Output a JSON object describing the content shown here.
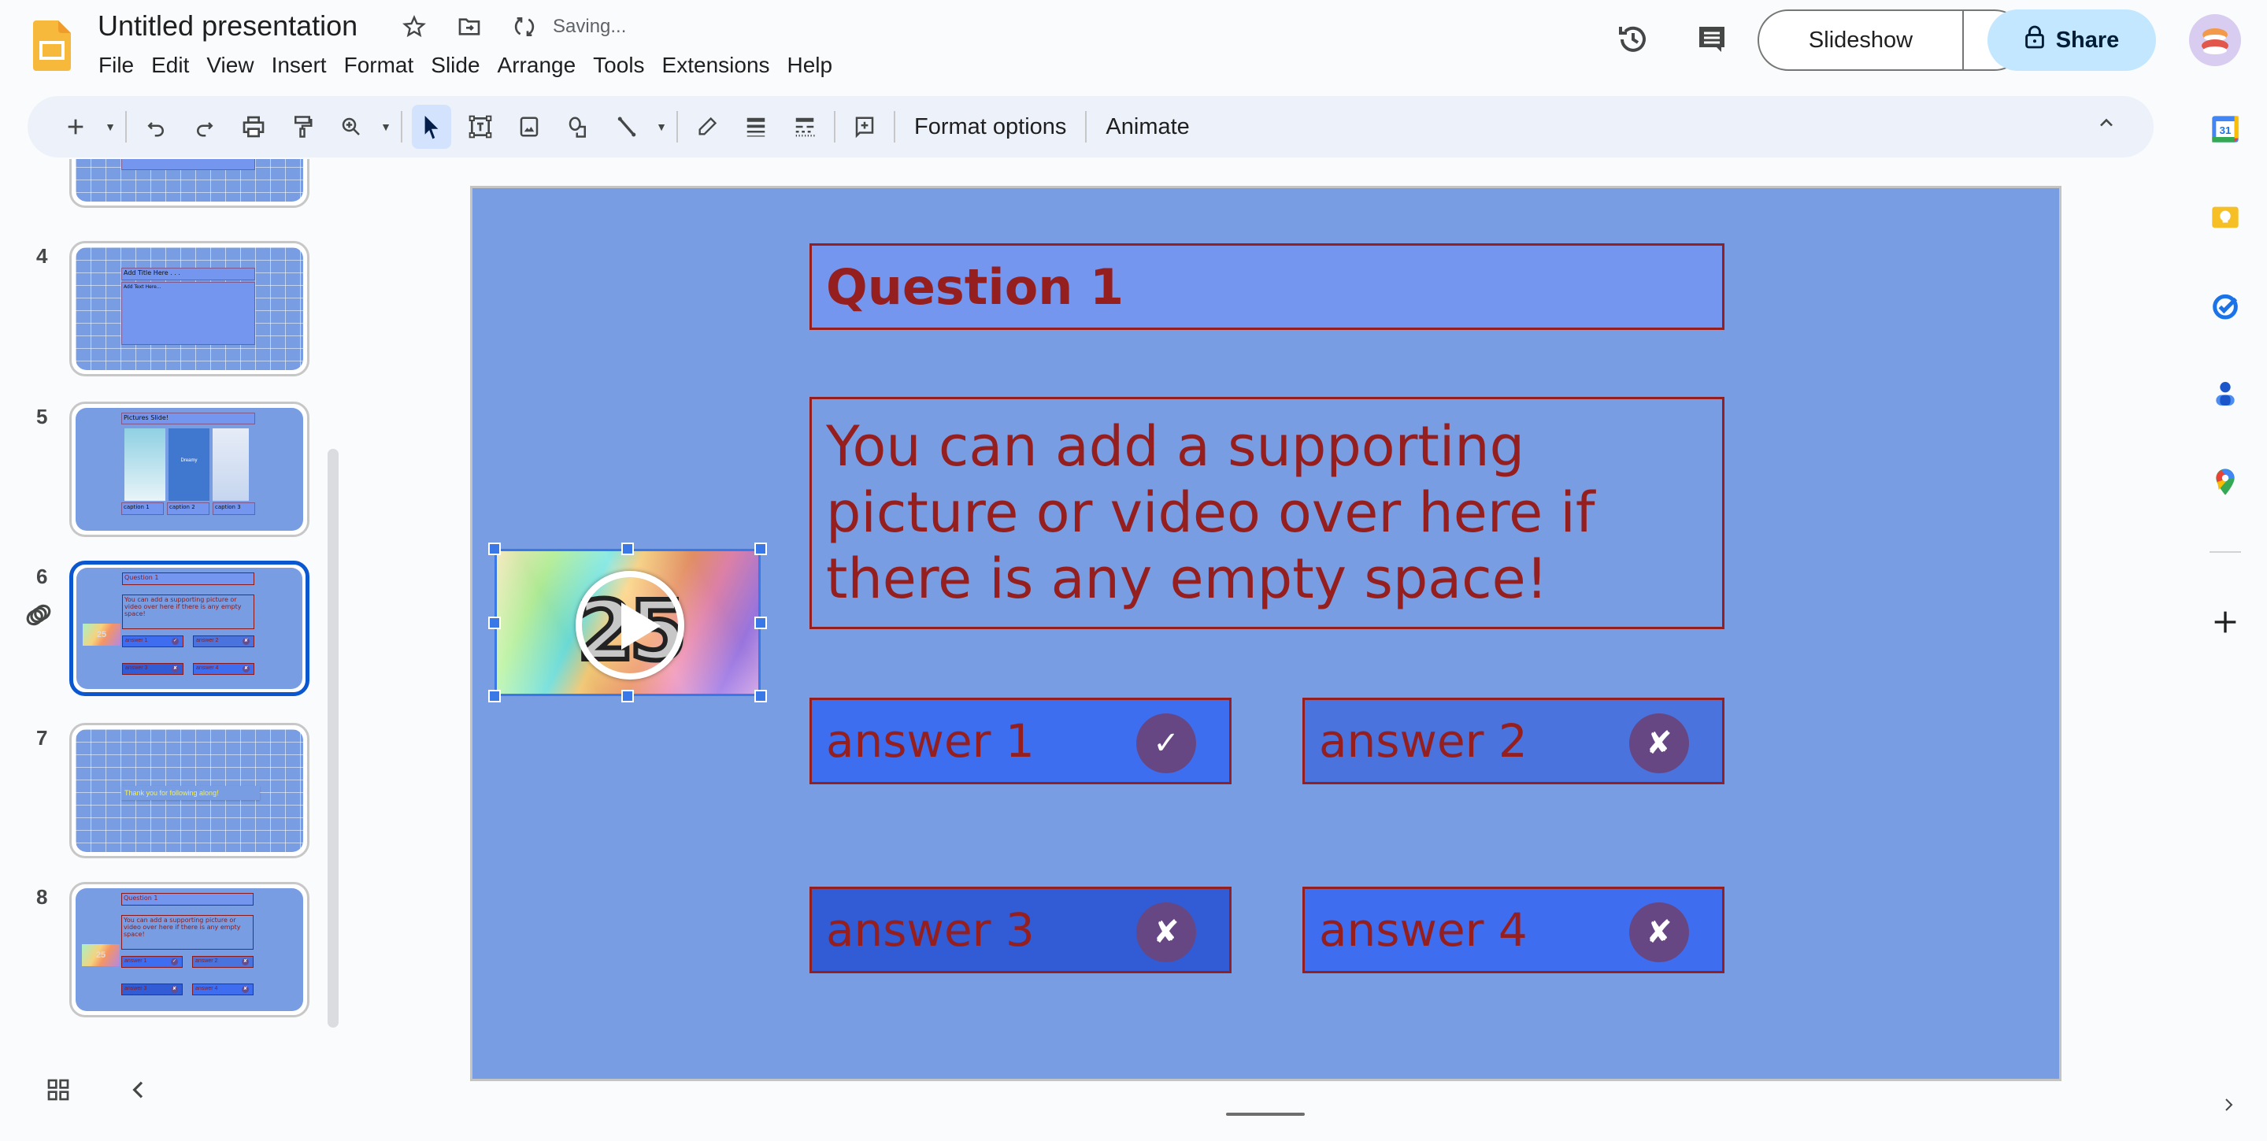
{
  "app": {
    "doc_title": "Untitled presentation",
    "save_status": "Saving...",
    "menu": [
      "File",
      "Edit",
      "View",
      "Insert",
      "Format",
      "Slide",
      "Arrange",
      "Tools",
      "Extensions",
      "Help"
    ],
    "slideshow_label": "Slideshow",
    "share_label": "Share"
  },
  "toolbar": {
    "format_options": "Format options",
    "animate": "Animate"
  },
  "filmstrip": {
    "slides": [
      {
        "number": "4",
        "title": "Add Title Here . . .",
        "body": "Add Text Here..."
      },
      {
        "number": "5",
        "title": "Pictures Slide!",
        "center_text": "Dreamy",
        "captions": [
          "caption 1",
          "caption 2",
          "caption 3"
        ]
      },
      {
        "number": "6",
        "title": "Question 1",
        "body": "You can add a supporting picture or video over here if there is any empty space!",
        "answers": [
          "answer 1",
          "answer 2",
          "answer 3",
          "answer 4"
        ],
        "video_label": "25",
        "selected": true
      },
      {
        "number": "7",
        "title": "Thank you for following along!"
      },
      {
        "number": "8",
        "title": "Question 1",
        "body": "You can add a supporting picture or video over here if there is any empty space!",
        "answers": [
          "answer 1",
          "answer 2",
          "answer 3",
          "answer 4"
        ],
        "video_label": "25"
      }
    ]
  },
  "slide": {
    "title": "Question 1",
    "body": "You can add a supporting picture or video over here if there is any empty space!",
    "video_label": "25",
    "answers": [
      {
        "label": "answer 1",
        "mark": "✓",
        "correct": true,
        "color": "#3d6ef0"
      },
      {
        "label": "answer 2",
        "mark": "✘",
        "correct": false,
        "color": "#4a73dd"
      },
      {
        "label": "answer 3",
        "mark": "✘",
        "correct": false,
        "color": "#325bd6"
      },
      {
        "label": "answer 4",
        "mark": "✘",
        "correct": false,
        "color": "#3f6df0"
      }
    ],
    "colors": {
      "background": "#789de3",
      "text": "#951f1f",
      "title_fill": "#7596ef",
      "mark_fill": "#664783"
    }
  },
  "side_panel": [
    "calendar-icon",
    "keep-icon",
    "tasks-icon",
    "contacts-icon",
    "maps-icon",
    "add-icon"
  ]
}
